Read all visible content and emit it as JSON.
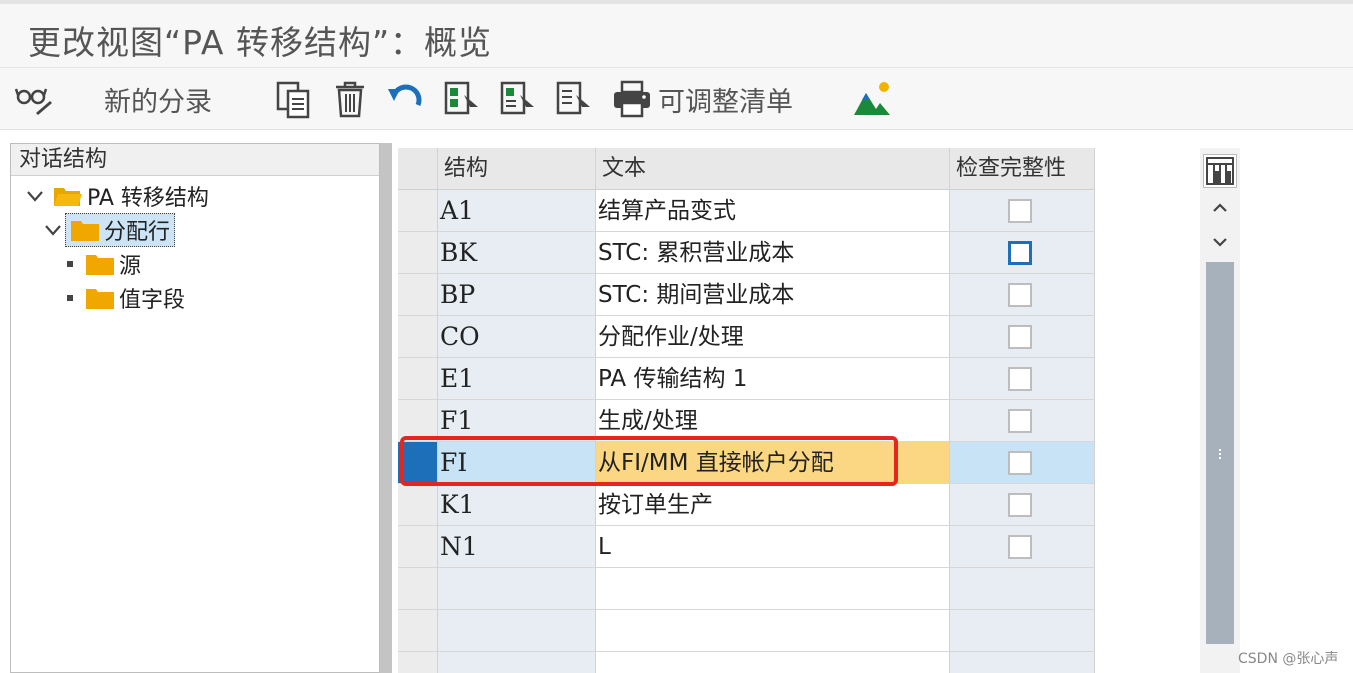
{
  "window": {
    "title": "更改视图“PA 转移结构”：概览"
  },
  "toolbar": {
    "new_entries_label": "新的分录",
    "adjustable_list_label": "可调整清单",
    "icons": [
      "glasses-edit-icon",
      "copy-icon",
      "delete-icon",
      "undo-icon",
      "select-all-icon",
      "select-block-icon",
      "deselect-all-icon",
      "print-icon",
      "landscape-icon"
    ]
  },
  "dialog_structure": {
    "header": "对话结构",
    "nodes": [
      {
        "label": "PA 转移结构",
        "level": 0,
        "expanded": true
      },
      {
        "label": "分配行",
        "level": 1,
        "expanded": true,
        "selected": true
      },
      {
        "label": "源",
        "level": 2
      },
      {
        "label": "值字段",
        "level": 2
      }
    ]
  },
  "table": {
    "columns": [
      "结构",
      "文本",
      "检查完整性"
    ],
    "rows": [
      {
        "key": "A1",
        "text": "结算产品变式",
        "checked": false
      },
      {
        "key": "BK",
        "text": "STC: 累积营业成本",
        "checked": false,
        "focused": true
      },
      {
        "key": "BP",
        "text": "STC: 期间营业成本",
        "checked": false
      },
      {
        "key": "CO",
        "text": "分配作业/处理",
        "checked": false
      },
      {
        "key": "E1",
        "text": "PA 传输结构 1",
        "checked": false
      },
      {
        "key": "F1",
        "text": "生成/处理",
        "checked": false
      },
      {
        "key": "FI",
        "text": "从FI/MM 直接帐户分配",
        "checked": false,
        "highlighted": true
      },
      {
        "key": "K1",
        "text": "按订单生产",
        "checked": false
      },
      {
        "key": "N1",
        "text": "L",
        "checked": false
      }
    ],
    "empty_rows": 3
  },
  "watermark": "CSDN @张心声",
  "colors": {
    "highlight_row": "#fbd783",
    "selection_blue": "#1c6fb8",
    "annotation_red": "#e5261f"
  }
}
